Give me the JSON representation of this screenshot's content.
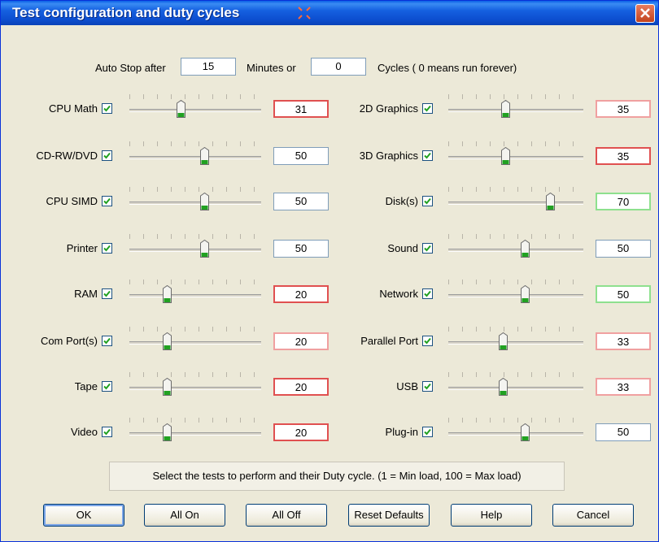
{
  "window": {
    "title": "Test configuration and duty cycles"
  },
  "autostop": {
    "prefix": "Auto Stop after",
    "minutes_value": "15",
    "minutes_label": "Minutes or",
    "cycles_value": "0",
    "cycles_label": "Cycles ( 0 means run forever)"
  },
  "tests_left": [
    {
      "label": "CPU Math",
      "checked": true,
      "duty": 31,
      "value": "31"
    },
    {
      "label": "CD-RW/DVD",
      "checked": true,
      "duty": 50,
      "value": "50"
    },
    {
      "label": "CPU SIMD",
      "checked": true,
      "duty": 50,
      "value": "50"
    },
    {
      "label": "Printer",
      "checked": true,
      "duty": 50,
      "value": "50"
    },
    {
      "label": "RAM",
      "checked": true,
      "duty": 20,
      "value": "20"
    },
    {
      "label": "Com Port(s)",
      "checked": true,
      "duty": 20,
      "value": "20"
    },
    {
      "label": "Tape",
      "checked": true,
      "duty": 20,
      "value": "20"
    },
    {
      "label": "Video",
      "checked": true,
      "duty": 20,
      "value": "20"
    }
  ],
  "tests_right": [
    {
      "label": "2D Graphics",
      "checked": true,
      "duty": 35,
      "value": "35"
    },
    {
      "label": "3D Graphics",
      "checked": true,
      "duty": 35,
      "value": "35"
    },
    {
      "label": "Disk(s)",
      "checked": true,
      "duty": 70,
      "value": "70"
    },
    {
      "label": "Sound",
      "checked": true,
      "duty": 50,
      "value": "50"
    },
    {
      "label": "Network",
      "checked": true,
      "duty": 50,
      "value": "50"
    },
    {
      "label": "Parallel Port",
      "checked": true,
      "duty": 33,
      "value": "33"
    },
    {
      "label": "USB",
      "checked": true,
      "duty": 33,
      "value": "33"
    },
    {
      "label": "Plug-in",
      "checked": true,
      "duty": 50,
      "value": "50"
    }
  ],
  "hint": "Select the tests to perform and their Duty cycle. (1 = Min load, 100 = Max load)",
  "buttons": {
    "ok": "OK",
    "all_on": "All On",
    "all_off": "All Off",
    "reset": "Reset Defaults",
    "help": "Help",
    "cancel": "Cancel"
  },
  "colors": {
    "titlebar": "#0a4fd0",
    "check_mark": "#21a121",
    "thumb_accent": "#21a121",
    "red_border": "#e05050",
    "green_border": "#8ee08e"
  }
}
